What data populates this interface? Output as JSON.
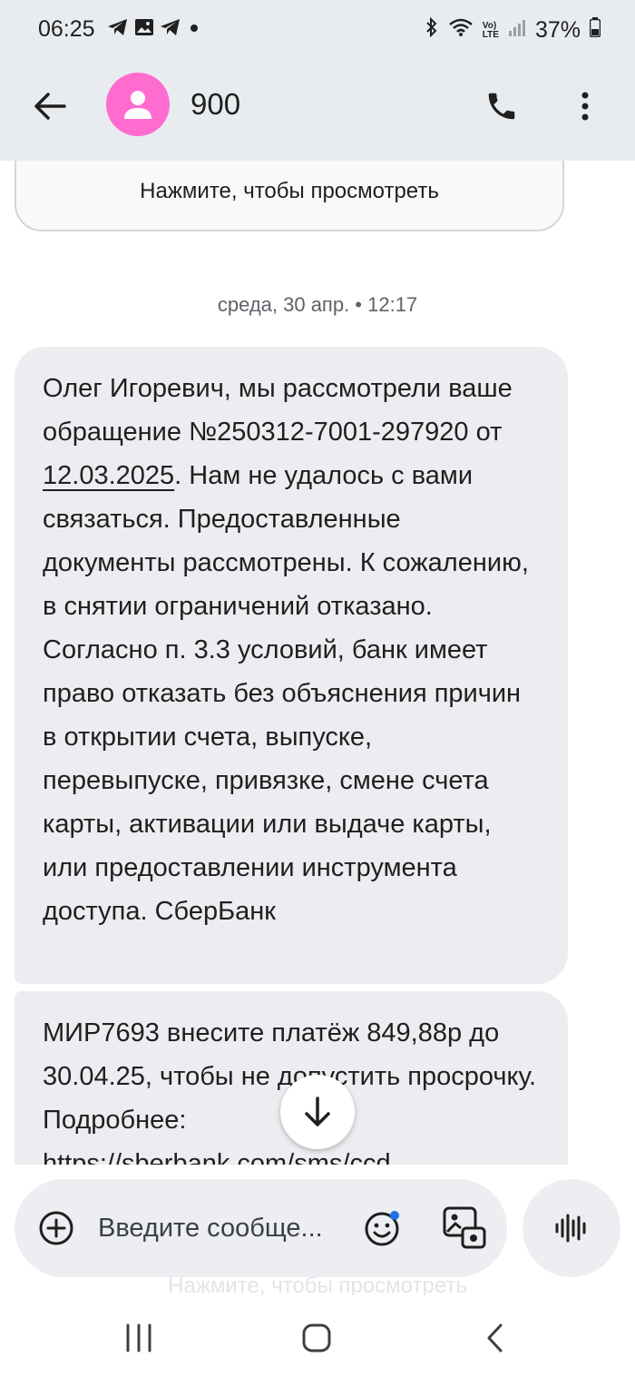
{
  "status": {
    "time": "06:25",
    "battery": "37%",
    "network_badge_top": "Vo)",
    "network_badge_bottom": "LTE"
  },
  "header": {
    "contact_name": "900"
  },
  "thread": {
    "previous_card_label": "Нажмите, чтобы просмотреть",
    "date_separator": "среда, 30 апр. • 12:17",
    "message1": {
      "before_link": "Олег Игоревич, мы рассмотрели ваше обращение №250312-7001-297920 от ",
      "linked_date": "12.03.2025",
      "after_link": ". Нам не удалось с вами связаться. Предоставленные документы рассмотрены. К сожалению, в снятии ограничений отказано. Согласно п. 3.3 условий, банк имеет право отказать без объяснения причин в открытии счета, выпуске, перевыпуске, привязке, смене счета карты, активации или выдаче карты, или предоставлении инструмента доступа. СберБанк"
    },
    "message2": {
      "text": "МИР7693 внесите платёж 849,88р до 30.04.25, чтобы не допустить просрочку. Подробнее:",
      "link": "https://sberbank.com/sms/ccd"
    },
    "faded_label": "Нажмите, чтобы просмотреть"
  },
  "composer": {
    "placeholder": "Введите сообще..."
  },
  "colors": {
    "avatar": "#ff6ccf",
    "bubble": "#ecedf0",
    "header_bg": "#e9ecef",
    "notification_dot": "#1a73e8"
  }
}
